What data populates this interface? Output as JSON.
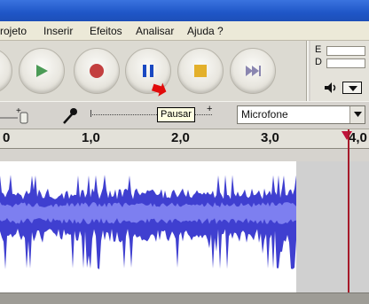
{
  "menu": {
    "items": [
      {
        "label": "rojeto"
      },
      {
        "label": "Inserir"
      },
      {
        "label": "Efeitos"
      },
      {
        "label": "Analisar"
      },
      {
        "label": "Ajuda ?"
      }
    ]
  },
  "transport": {
    "tooltip": "Pausar"
  },
  "meter": {
    "label_e": "E",
    "label_d": "D"
  },
  "mixer": {
    "input_source": "Microfone"
  },
  "ruler": {
    "ticks": [
      "0",
      "1,0",
      "2,0",
      "3,0",
      "4,0"
    ]
  },
  "colors": {
    "waveform": "#3f3fd0",
    "waveform_light": "#7d7ff0",
    "playhead": "#a61a2a",
    "record": "#c33f3f",
    "play": "#4b9b56",
    "pause": "#1a49c2",
    "stop": "#e3b02b",
    "skip": "#8a86b0"
  }
}
